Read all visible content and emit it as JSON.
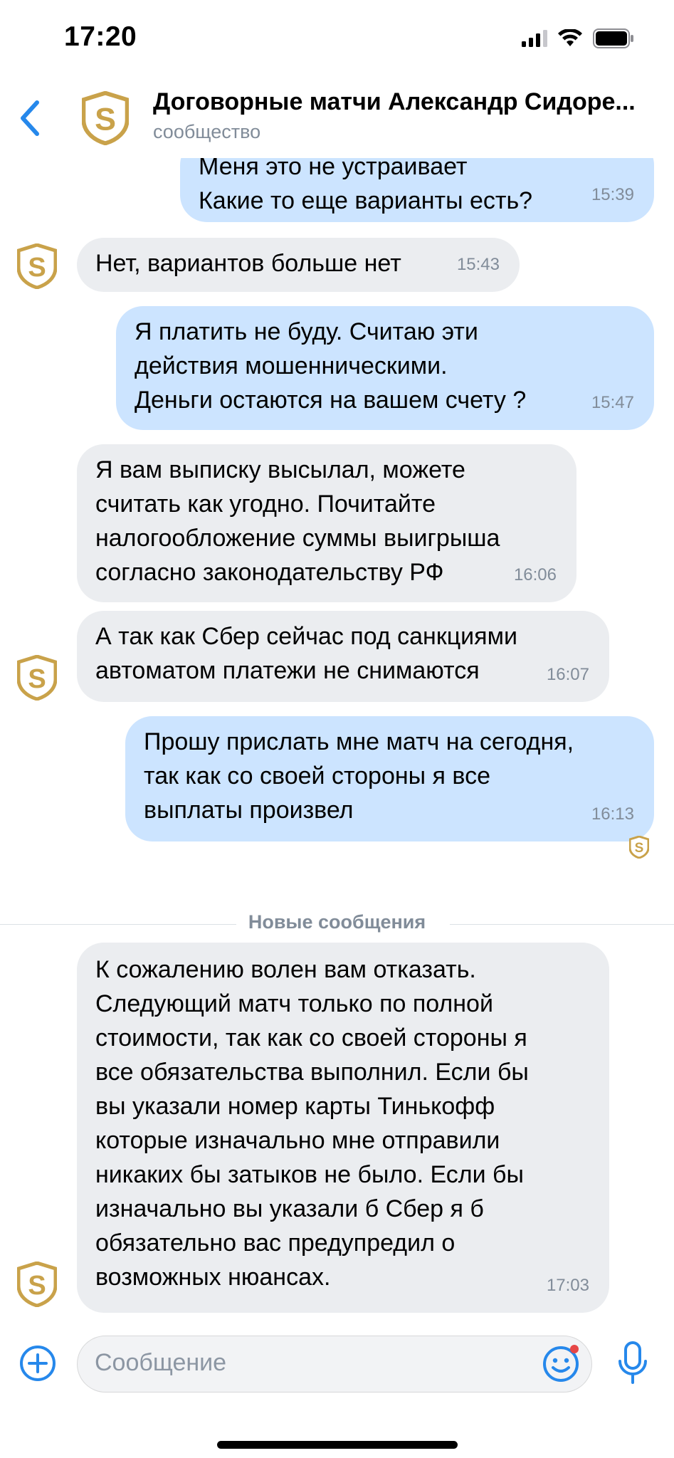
{
  "status": {
    "time": "17:20"
  },
  "header": {
    "title": "Договорные матчи Александр Сидоре...",
    "subtitle": "сообщество"
  },
  "messages": [
    {
      "dir": "out",
      "text": "Меня это не устраивает\nКакие то еще варианты есть?",
      "time": "15:39"
    },
    {
      "dir": "in",
      "text": "Нет, вариантов больше нет",
      "time": "15:43"
    },
    {
      "dir": "out",
      "text": "Я платить не буду. Считаю эти\nдействия мошенническими.\nДеньги остаются на вашем счету ?",
      "time": "15:47"
    },
    {
      "dir": "in",
      "text": "Я вам выписку высылал, можете\nсчитать как угодно. Почитайте\nналогообложение суммы выигрыша\nсогласно законодательству РФ",
      "time": "16:06"
    },
    {
      "dir": "in",
      "text": "А так как Сбер сейчас под санкциями\nавтоматом платежи не снимаются",
      "time": "16:07"
    },
    {
      "dir": "out",
      "text": "Прошу прислать мне матч на сегодня,\nтак как со своей стороны я все\nвыплаты произвел",
      "time": "16:13"
    },
    {
      "dir": "in",
      "text": "К сожалению волен вам отказать.\nСледующий матч только по полной\nстоимости, так как со своей стороны я\nвсе обязательства выполнил. Если бы\nвы указали номер карты Тинькофф\nкоторые изначально мне отправили\nникаких бы затыков не было. Если бы\nизначально вы указали б Сбер я б\nобязательно вас предупредил о\nвозможных нюансах.",
      "time": "17:03"
    }
  ],
  "divider": {
    "label": "Новые сообщения"
  },
  "composer": {
    "placeholder": "Сообщение"
  },
  "colors": {
    "accent": "#2688eb",
    "incoming": "#ebedf0",
    "outgoing": "#cce4ff",
    "logo": "#c9a24a"
  }
}
